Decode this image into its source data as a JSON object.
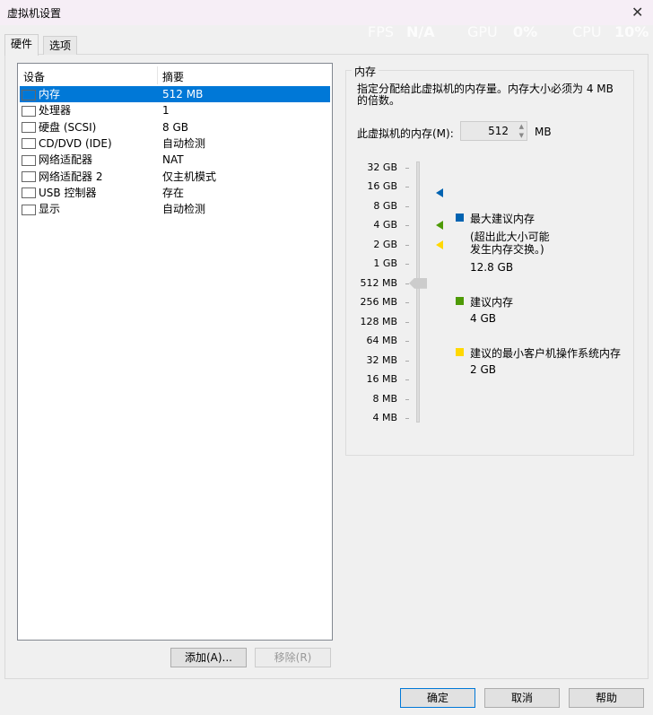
{
  "window": {
    "title": "虚拟机设置",
    "close": "✕"
  },
  "overlay": {
    "fps_label": "FPS",
    "fps": "N/A",
    "gpu_label": "GPU",
    "gpu": "0%",
    "cpu_label": "CPU",
    "cpu": "10%"
  },
  "tabs": [
    "硬件",
    "选项"
  ],
  "devices": {
    "col_device": "设备",
    "col_summary": "摘要",
    "rows": [
      {
        "name": "内存",
        "summary": "512 MB",
        "icon": "memory-icon"
      },
      {
        "name": "处理器",
        "summary": "1",
        "icon": "cpu-icon"
      },
      {
        "name": "硬盘 (SCSI)",
        "summary": "8 GB",
        "icon": "disk-icon"
      },
      {
        "name": "CD/DVD (IDE)",
        "summary": "自动检测",
        "icon": "cd-icon"
      },
      {
        "name": "网络适配器",
        "summary": "NAT",
        "icon": "network-icon"
      },
      {
        "name": "网络适配器 2",
        "summary": "仅主机模式",
        "icon": "network-icon"
      },
      {
        "name": "USB 控制器",
        "summary": "存在",
        "icon": "usb-icon"
      },
      {
        "name": "显示",
        "summary": "自动检测",
        "icon": "monitor-icon"
      }
    ]
  },
  "buttons": {
    "add": "添加(A)...",
    "remove": "移除(R)",
    "ok": "确定",
    "cancel": "取消",
    "help": "帮助"
  },
  "memory": {
    "group": "内存",
    "desc": "指定分配给此虚拟机的内存量。内存大小必须为 4 MB 的倍数。",
    "field_label": "此虚拟机的内存(M):",
    "value": "512",
    "unit": "MB",
    "ticks": [
      "32 GB",
      "16 GB",
      "8 GB",
      "4 GB",
      "2 GB",
      "1 GB",
      "512 MB",
      "256 MB",
      "128 MB",
      "64 MB",
      "32 MB",
      "16 MB",
      "8 MB",
      "4 MB"
    ],
    "slider_value_mb": 512,
    "legend": [
      {
        "title": "最大建议内存",
        "note1": "(超出此大小可能",
        "note2": "发生内存交换。)",
        "value": "12.8 GB",
        "color": "#0063b1",
        "mb": 13107
      },
      {
        "title": "建议内存",
        "value": "4 GB",
        "color": "#4e9a06",
        "mb": 4096
      },
      {
        "title": "建议的最小客户机操作系统内存",
        "value": "2 GB",
        "color": "#ffd800",
        "mb": 2048
      }
    ]
  }
}
